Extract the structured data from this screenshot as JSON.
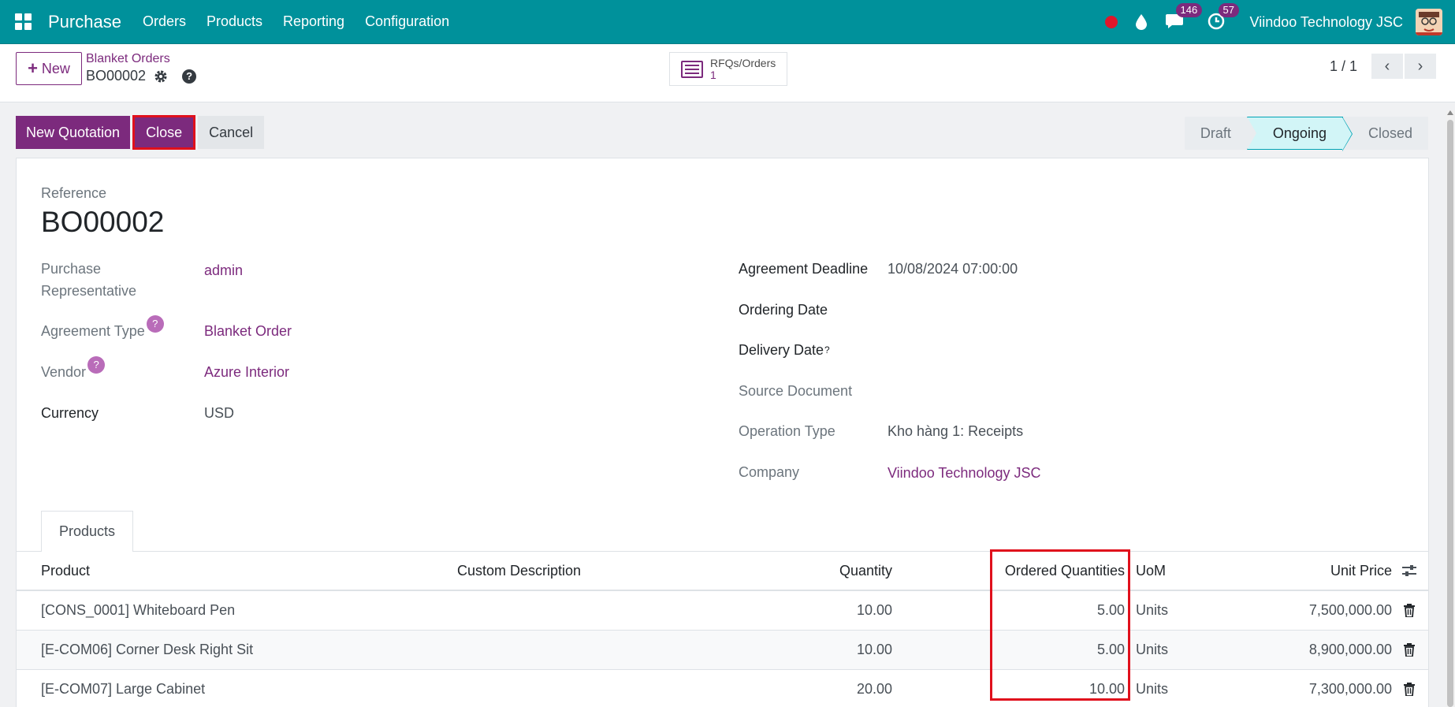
{
  "navbar": {
    "brand": "Purchase",
    "menu": [
      "Orders",
      "Products",
      "Reporting",
      "Configuration"
    ],
    "chat_badge": "146",
    "activity_badge": "57",
    "company": "Viindoo Technology JSC"
  },
  "control_panel": {
    "new_label": "New",
    "breadcrumb": "Blanket Orders",
    "record_name": "BO00002",
    "smart_button": {
      "label": "RFQs/Orders",
      "count": "1"
    },
    "pager": "1 / 1"
  },
  "actions": {
    "new_quotation": "New Quotation",
    "close": "Close",
    "cancel": "Cancel"
  },
  "statusbar": {
    "stages": [
      "Draft",
      "Ongoing",
      "Closed"
    ],
    "active": "Ongoing"
  },
  "form": {
    "reference_label": "Reference",
    "reference": "BO00002",
    "left": {
      "purchase_rep_label_1": "Purchase",
      "purchase_rep_label_2": "Representative",
      "purchase_rep": "admin",
      "agreement_type_label": "Agreement Type",
      "agreement_type": "Blanket Order",
      "vendor_label": "Vendor",
      "vendor": "Azure Interior",
      "currency_label": "Currency",
      "currency": "USD"
    },
    "right": {
      "agreement_deadline_label": "Agreement Deadline",
      "agreement_deadline": "10/08/2024 07:00:00",
      "ordering_date_label": "Ordering Date",
      "delivery_date_label": "Delivery Date",
      "source_document_label": "Source Document",
      "operation_type_label": "Operation Type",
      "operation_type": "Kho hàng 1: Receipts",
      "company_label": "Company",
      "company": "Viindoo Technology JSC"
    },
    "help_mark": "?"
  },
  "notebook": {
    "tab": "Products",
    "columns": {
      "product": "Product",
      "description": "Custom Description",
      "quantity": "Quantity",
      "ordered": "Ordered Quantities",
      "uom": "UoM",
      "unit_price": "Unit Price"
    },
    "rows": [
      {
        "product": "[CONS_0001] Whiteboard Pen",
        "quantity": "10.00",
        "ordered": "5.00",
        "uom": "Units",
        "price": "7,500,000.00"
      },
      {
        "product": "[E-COM06] Corner Desk Right Sit",
        "quantity": "10.00",
        "ordered": "5.00",
        "uom": "Units",
        "price": "8,900,000.00"
      },
      {
        "product": "[E-COM07] Large Cabinet",
        "quantity": "20.00",
        "ordered": "10.00",
        "uom": "Units",
        "price": "7,300,000.00"
      }
    ]
  },
  "colors": {
    "navbar": "#00919b",
    "primary": "#7c2a7d",
    "highlight": "#e0101c"
  }
}
